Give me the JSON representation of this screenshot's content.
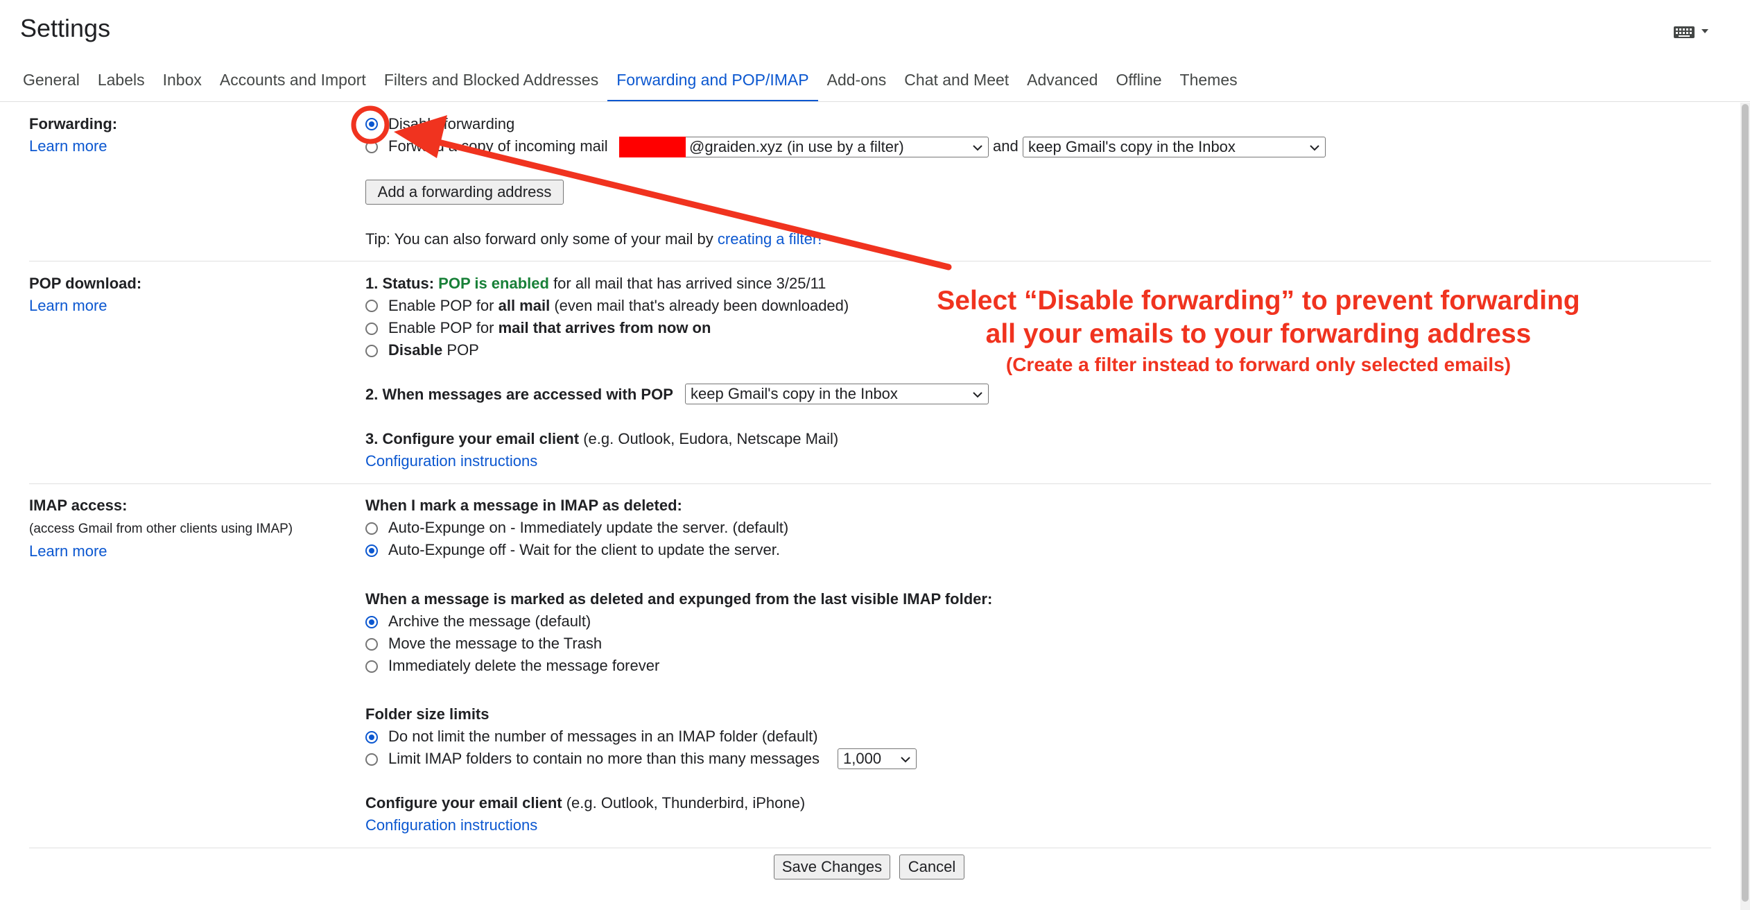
{
  "header": {
    "title": "Settings",
    "keyboard_icon": "keyboard-icon"
  },
  "tabs": [
    {
      "label": "General"
    },
    {
      "label": "Labels"
    },
    {
      "label": "Inbox"
    },
    {
      "label": "Accounts and Import"
    },
    {
      "label": "Filters and Blocked Addresses"
    },
    {
      "label": "Forwarding and POP/IMAP",
      "active": true
    },
    {
      "label": "Add-ons"
    },
    {
      "label": "Chat and Meet"
    },
    {
      "label": "Advanced"
    },
    {
      "label": "Offline"
    },
    {
      "label": "Themes"
    }
  ],
  "forwarding": {
    "label": "Forwarding:",
    "learn_more": "Learn more",
    "disable_label": "Disable forwarding",
    "forward_label": "Forward a copy of incoming mail",
    "forward_address": "@graiden.xyz (in use by a filter)",
    "and_text": "and",
    "copy_option": "keep Gmail's copy in the Inbox",
    "add_button": "Add a forwarding address",
    "tip_prefix": "Tip: You can also forward only some of your mail by",
    "tip_link": "creating a filter!"
  },
  "pop": {
    "label": "POP download:",
    "learn_more": "Learn more",
    "status_prefix": "1. Status:",
    "status_value": "POP is enabled",
    "status_suffix": "for all mail that has arrived since 3/25/11",
    "opt1_prefix": "Enable POP for",
    "opt1_bold": "all mail",
    "opt1_suffix": "(even mail that's already been downloaded)",
    "opt2_prefix": "Enable POP for",
    "opt2_bold": "mail that arrives from now on",
    "opt3_bold": "Disable",
    "opt3_suffix": "POP",
    "accessed_label": "2. When messages are accessed with POP",
    "accessed_option": "keep Gmail's copy in the Inbox",
    "configure_bold": "3. Configure your email client",
    "configure_suffix": "(e.g. Outlook, Eudora, Netscape Mail)",
    "config_link": "Configuration instructions"
  },
  "imap": {
    "label": "IMAP access:",
    "sublabel": "(access Gmail from other clients using IMAP)",
    "learn_more": "Learn more",
    "deleted_heading": "When I mark a message in IMAP as deleted:",
    "auto_on": "Auto-Expunge on - Immediately update the server. (default)",
    "auto_off": "Auto-Expunge off - Wait for the client to update the server.",
    "expunged_heading": "When a message is marked as deleted and expunged from the last visible IMAP folder:",
    "archive": "Archive the message (default)",
    "trash": "Move the message to the Trash",
    "delete_forever": "Immediately delete the message forever",
    "folder_heading": "Folder size limits",
    "no_limit": "Do not limit the number of messages in an IMAP folder (default)",
    "limit": "Limit IMAP folders to contain no more than this many messages",
    "limit_value": "1,000",
    "configure_bold": "Configure your email client",
    "configure_suffix": "(e.g. Outlook, Thunderbird, iPhone)",
    "config_link": "Configuration instructions"
  },
  "footer": {
    "save": "Save Changes",
    "cancel": "Cancel"
  },
  "annotation": {
    "line1": "Select “Disable forwarding” to prevent forwarding",
    "line2": "all your emails to your forwarding address",
    "line3": "(Create a filter instead to forward only selected emails)",
    "color": "#f0331f"
  },
  "colors": {
    "accent": "#0b57d0",
    "pop_enabled": "#188038",
    "annotation": "#f0331f",
    "redaction": "#ff0000"
  }
}
